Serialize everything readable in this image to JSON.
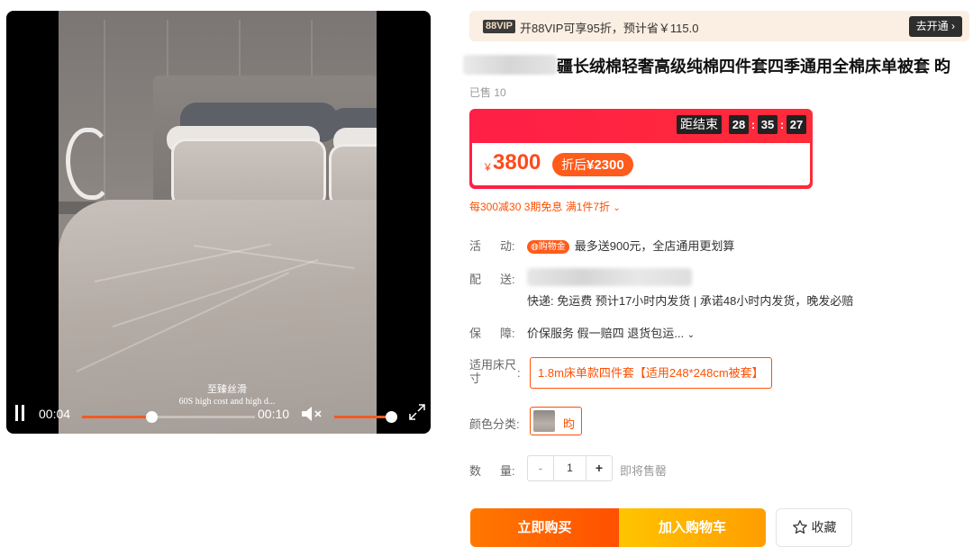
{
  "video": {
    "current_time": "00:04",
    "total_time": "00:10",
    "progress_fraction": 0.4,
    "volume_fraction": 0.9,
    "caption_line1": "至臻丝滑",
    "caption_line2": "60S high cost and high d..."
  },
  "vip": {
    "badge": "88VIP",
    "text": "开88VIP可享95折，预计省￥115.0",
    "button": "去开通 ›"
  },
  "product": {
    "title": "疆长绒棉轻奢高级纯棉四件套四季通用全棉床单被套 昀",
    "sold": "已售 10"
  },
  "price": {
    "countdown_label": "距结束",
    "countdown": [
      "28",
      "35",
      "27"
    ],
    "currency": "¥",
    "value": "3800",
    "after_label": "折后",
    "after_value": "¥2300"
  },
  "promo": {
    "text": "每300减30 3期免息 满1件7折",
    "chevron": "⌄"
  },
  "activity": {
    "label_a": "活",
    "label_b": "动:",
    "badge": "购物金",
    "text": "最多送900元，全店通用更划算"
  },
  "delivery": {
    "label_a": "配",
    "label_b": "送:",
    "text": "快递: 免运费  预计17小时内发货 | 承诺48小时内发货，晚发必赔"
  },
  "guarantee": {
    "label_a": "保",
    "label_b": "障:",
    "text": "价保服务 假一赔四 退货包运...",
    "chevron": "⌄"
  },
  "size": {
    "label_line1": "适用床尺",
    "label_line2": "寸",
    "colon": ":",
    "option": "1.8m床单款四件套【适用248*248cm被套】"
  },
  "color": {
    "label": "颜色分类:",
    "option": "昀"
  },
  "quantity": {
    "label_a": "数",
    "label_b": "量:",
    "minus": "-",
    "value": "1",
    "plus": "+",
    "note": "即将售罄"
  },
  "actions": {
    "buy": "立即购买",
    "cart": "加入购物车",
    "favorite": "收藏"
  },
  "colors": {
    "accent": "#ff5000",
    "price_red": "#ff2b39",
    "cart_yellow": "#ffc400"
  }
}
